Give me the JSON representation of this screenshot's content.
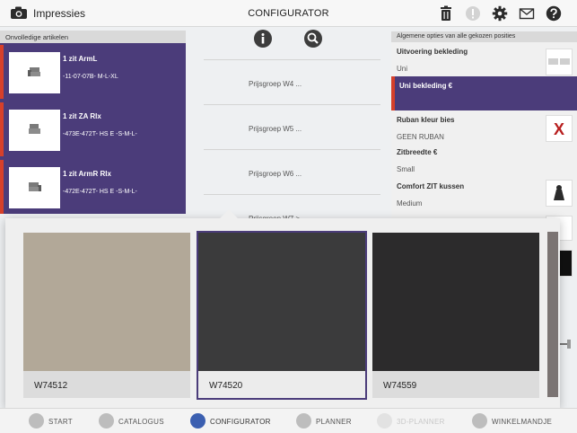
{
  "topbar": {
    "app_title": "Impressies",
    "center_title": "CONFIGURATOR",
    "icons": [
      "trash-icon",
      "alert-icon",
      "gear-icon",
      "mail-icon",
      "help-icon"
    ]
  },
  "left_panel": {
    "header": "Onvolledige artikelen",
    "items": [
      {
        "name": "1 zit ArmL",
        "code": "-11-07-07B- M-L-XL"
      },
      {
        "name": "1 zit ZA Rlx",
        "code": "-473E-472T- HS E -S-M-L-"
      },
      {
        "name": "1 zit ArmR Rlx",
        "code": "-472E-472T- HS E -S-M-L-"
      }
    ]
  },
  "center": {
    "price_groups": [
      "Prijsgroep W4 ...",
      "Prijsgroep W5 ...",
      "Prijsgroep W6 ...",
      "Prijsgroep W7 >"
    ]
  },
  "right_panel": {
    "header": "Algemene opties van alle gekozen posities",
    "options": [
      {
        "label": "Uitvoering bekleding",
        "value": "Uni"
      },
      {
        "label": "Uni bekleding €",
        "value": ""
      },
      {
        "label": "Ruban kleur bies",
        "value": "GEEN RUBAN"
      },
      {
        "label": "Zitbreedte €",
        "value": "Small"
      },
      {
        "label": "Comfort ZIT kussen",
        "value": "Medium"
      }
    ],
    "x_mark": "X"
  },
  "swatches": [
    {
      "code": "W74512",
      "color": "#b2a898"
    },
    {
      "code": "W74520",
      "color": "#3b3b3c"
    },
    {
      "code": "W74559",
      "color": "#2c2b2c"
    }
  ],
  "colors": {
    "accent_purple": "#4b3c7a",
    "accent_red": "#d6402a",
    "active_blue": "#3b5fb0"
  },
  "bottom_nav": [
    {
      "label": "START",
      "icon": "home-icon"
    },
    {
      "label": "CATALOGUS",
      "icon": "grid-icon"
    },
    {
      "label": "CONFIGURATOR",
      "icon": "wrench-icon"
    },
    {
      "label": "PLANNER",
      "icon": "pencil-icon"
    },
    {
      "label": "3D-PLANNER",
      "icon": "cube-icon"
    },
    {
      "label": "WINKELMANDJE",
      "icon": "cart-icon"
    }
  ]
}
